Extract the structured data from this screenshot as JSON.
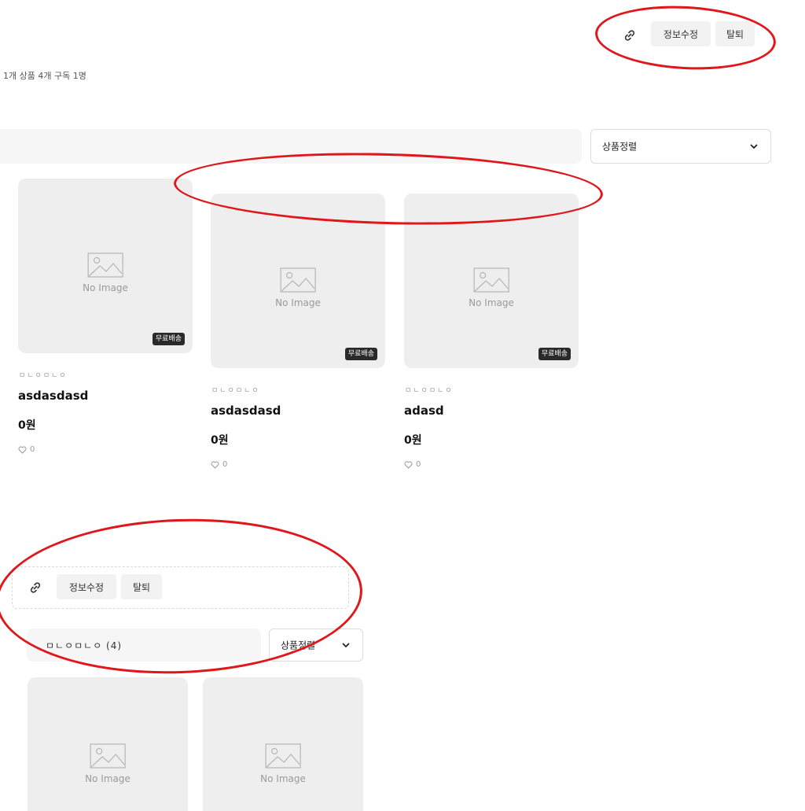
{
  "top_actions": {
    "link_icon": "link-icon",
    "edit_label": "정보수정",
    "withdraw_label": "탈퇴"
  },
  "stats_text": "1개  상품 4개  구독 1명",
  "sort": {
    "label": "상품정렬",
    "icon": "chevron-down-icon"
  },
  "products": [
    {
      "image_placeholder": "No Image",
      "badge": "무료배송",
      "shop": "ㅁㄴㅇㅁㄴㅇ",
      "name": "asdasdasd",
      "price": "0원",
      "likes": "0"
    },
    {
      "image_placeholder": "No Image",
      "badge": "무료배송",
      "shop": "ㅁㄴㅇㅁㄴㅇ",
      "name": "asdasdasd",
      "price": "0원",
      "likes": "0"
    },
    {
      "image_placeholder": "No Image",
      "badge": "무료배송",
      "shop": "ㅁㄴㅇㅁㄴㅇ",
      "name": "adasd",
      "price": "0원",
      "likes": "0"
    }
  ],
  "mobile": {
    "edit_label": "정보수정",
    "withdraw_label": "탈퇴",
    "shop_title": "ㅁㄴㅇㅁㄴㅇ (4)",
    "sort_label": "상품정렬",
    "cards": [
      {
        "image_placeholder": "No Image"
      },
      {
        "image_placeholder": "No Image"
      }
    ]
  },
  "annotation_color": "#e0161b"
}
